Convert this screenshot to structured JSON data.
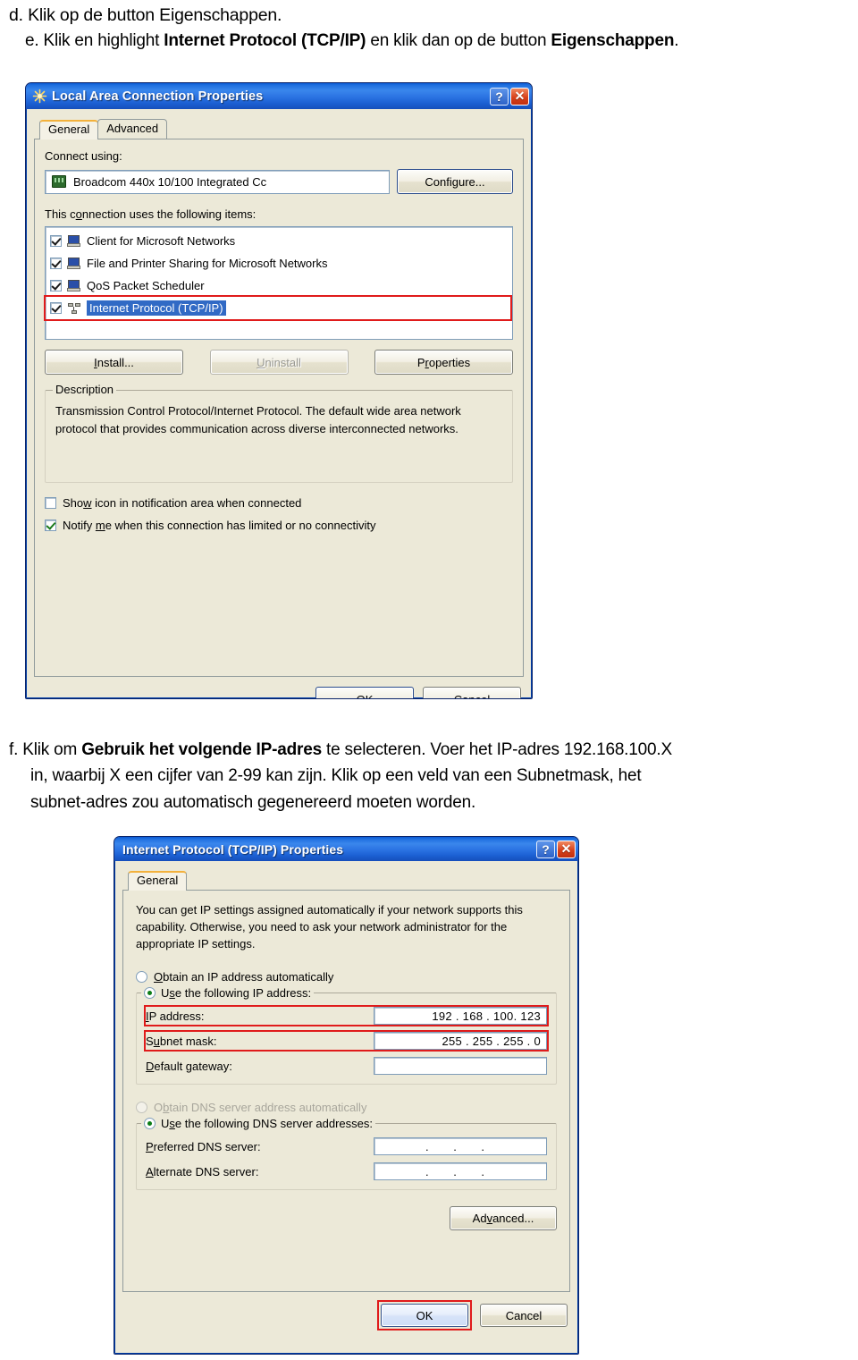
{
  "document": {
    "step_d": "d. Klik op de button Eigenschappen.",
    "step_e_pre": "e. Klik en highlight ",
    "step_e_bold1": "Internet Protocol (TCP/IP)",
    "step_e_mid": " en klik dan op de button ",
    "step_e_bold2": "Eigenschappen",
    "step_e_end": ".",
    "step_f_pre": "f. Klik om ",
    "step_f_bold": "Gebruik het volgende IP-adres",
    "step_f_post": " te selecteren. Voer het IP-adres 192.168.100.X",
    "step_f_line2": "in, waarbij X een cijfer van 2-99 kan zijn. Klik op een veld van een Subnetmask, het",
    "step_f_line3": "subnet-adres zou automatisch gegenereerd moeten worden."
  },
  "lan_dialog": {
    "title": "Local Area Connection Properties",
    "help_glyph": "?",
    "close_glyph": "✕",
    "tabs": [
      {
        "label": "General",
        "active": true
      },
      {
        "label": "Advanced",
        "active": false
      }
    ],
    "connect_using_label": "Connect using:",
    "adapter_name": "Broadcom 440x 10/100 Integrated Cc",
    "configure_button": "Configure...",
    "items_label": "This connection uses the following items:",
    "items": [
      {
        "label": "Client for Microsoft Networks",
        "checked": true,
        "selected": false,
        "icon": "computer-icon"
      },
      {
        "label": "File and Printer Sharing for Microsoft Networks",
        "checked": true,
        "selected": false,
        "icon": "computer-icon"
      },
      {
        "label": "QoS Packet Scheduler",
        "checked": true,
        "selected": false,
        "icon": "computer-icon"
      },
      {
        "label": "Internet Protocol (TCP/IP)",
        "checked": true,
        "selected": true,
        "icon": "protocol-icon"
      }
    ],
    "install_button": "Install...",
    "uninstall_button": "Uninstall",
    "properties_button": "Properties",
    "description_group": "Description",
    "description_text": "Transmission Control Protocol/Internet Protocol. The default wide area network protocol that provides communication across diverse interconnected networks.",
    "show_icon_label": "Show icon in notification area when connected",
    "show_icon_checked": false,
    "notify_label": "Notify me when this connection has limited or no connectivity",
    "notify_checked": true,
    "ok_button": "OK",
    "cancel_button": "Cancel"
  },
  "tcpip_dialog": {
    "title": "Internet Protocol (TCP/IP) Properties",
    "help_glyph": "?",
    "close_glyph": "✕",
    "tabs": [
      {
        "label": "General",
        "active": true
      }
    ],
    "intro_text": "You can get IP settings assigned automatically if your network supports this capability. Otherwise, you need to ask your network administrator for the appropriate IP settings.",
    "obtain_ip_label": "Obtain an IP address automatically",
    "obtain_ip_selected": false,
    "use_ip_label": "Use the following IP address:",
    "use_ip_selected": true,
    "ip_address_label": "IP address:",
    "ip_address_value": "192 . 168 . 100. 123",
    "subnet_label": "Subnet mask:",
    "subnet_value": "255 . 255 . 255 .   0",
    "gateway_label": "Default gateway:",
    "gateway_value": "",
    "obtain_dns_label": "Obtain DNS server address automatically",
    "obtain_dns_selected": false,
    "obtain_dns_disabled": true,
    "use_dns_label": "Use the following DNS server addresses:",
    "use_dns_selected": true,
    "preferred_dns_label": "Preferred DNS server:",
    "preferred_dns_value": ".    .    .",
    "alternate_dns_label": "Alternate DNS server:",
    "alternate_dns_value": ".    .    .",
    "advanced_button": "Advanced...",
    "ok_button": "OK",
    "cancel_button": "Cancel"
  },
  "colors": {
    "titlebar_blue": "#1b5fd2",
    "dialog_face": "#ece9d8",
    "selection_blue": "#316ac5",
    "highlight_red": "#e01b1b",
    "close_red": "#d8411b"
  }
}
